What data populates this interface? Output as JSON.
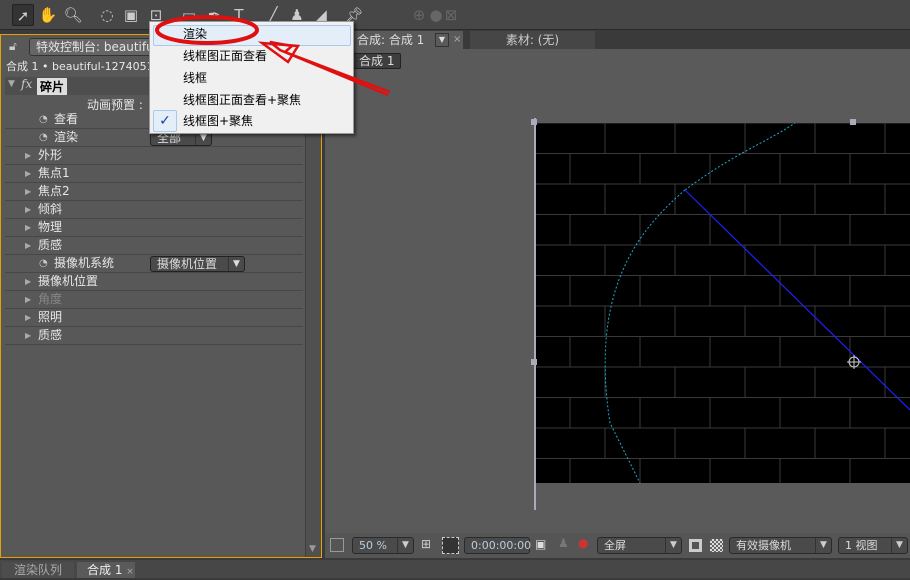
{
  "toolbar": {
    "tools": [
      "selection-tool",
      "hand-tool",
      "zoom-tool",
      "rotate-tool",
      "camera-tool",
      "pan-behind-tool",
      "rectangle-tool",
      "pen-tool",
      "text-tool",
      "brush-tool",
      "clone-stamp-tool",
      "eraser-tool",
      "puppet-pin-tool"
    ]
  },
  "left_panel": {
    "tab": "特效控制台: beautifu",
    "layer_path": "合成 1 • beautiful-1274051_",
    "effect_name": "碎片",
    "fx": "fx",
    "anim_preset_label": "动画预置 :",
    "rows": [
      {
        "label": "查看",
        "stopwatch": true
      },
      {
        "label": "渲染",
        "stopwatch": true,
        "value": "全部"
      },
      {
        "label": "外形"
      },
      {
        "label": "焦点1"
      },
      {
        "label": "焦点2"
      },
      {
        "label": "倾斜"
      },
      {
        "label": "物理"
      },
      {
        "label": "质感"
      },
      {
        "label": "摄像机系统",
        "stopwatch": true,
        "value": "摄像机位置"
      },
      {
        "label": "摄像机位置"
      },
      {
        "label": "角度",
        "disabled": true
      },
      {
        "label": "照明"
      },
      {
        "label": "质感"
      }
    ]
  },
  "menu": {
    "items": [
      {
        "label": "渲染",
        "highlighted": true
      },
      {
        "label": "线框图正面查看"
      },
      {
        "label": "线框"
      },
      {
        "label": "线框图正面查看+聚焦"
      },
      {
        "label": "线框图+聚焦",
        "checked": true
      }
    ],
    "check": "✓"
  },
  "right_panel": {
    "tabs": [
      {
        "label": "合成: 合成 1",
        "active": true
      },
      {
        "label": "素材: (无)"
      }
    ],
    "comp_button": "合成 1"
  },
  "viewer_bar": {
    "zoom": "50 %",
    "timecode": "0:00:00:00",
    "resolution": "全屏",
    "camera": "有效摄像机",
    "views": "1 视图"
  },
  "bottom_tabs": [
    {
      "label": "渲染队列"
    },
    {
      "label": "合成 1",
      "active": true
    }
  ],
  "colors": {
    "accent": "#e8a000",
    "annotation": "#e01010",
    "wire_blue": "#1a1aff",
    "wire_cyan": "#22aacc"
  }
}
